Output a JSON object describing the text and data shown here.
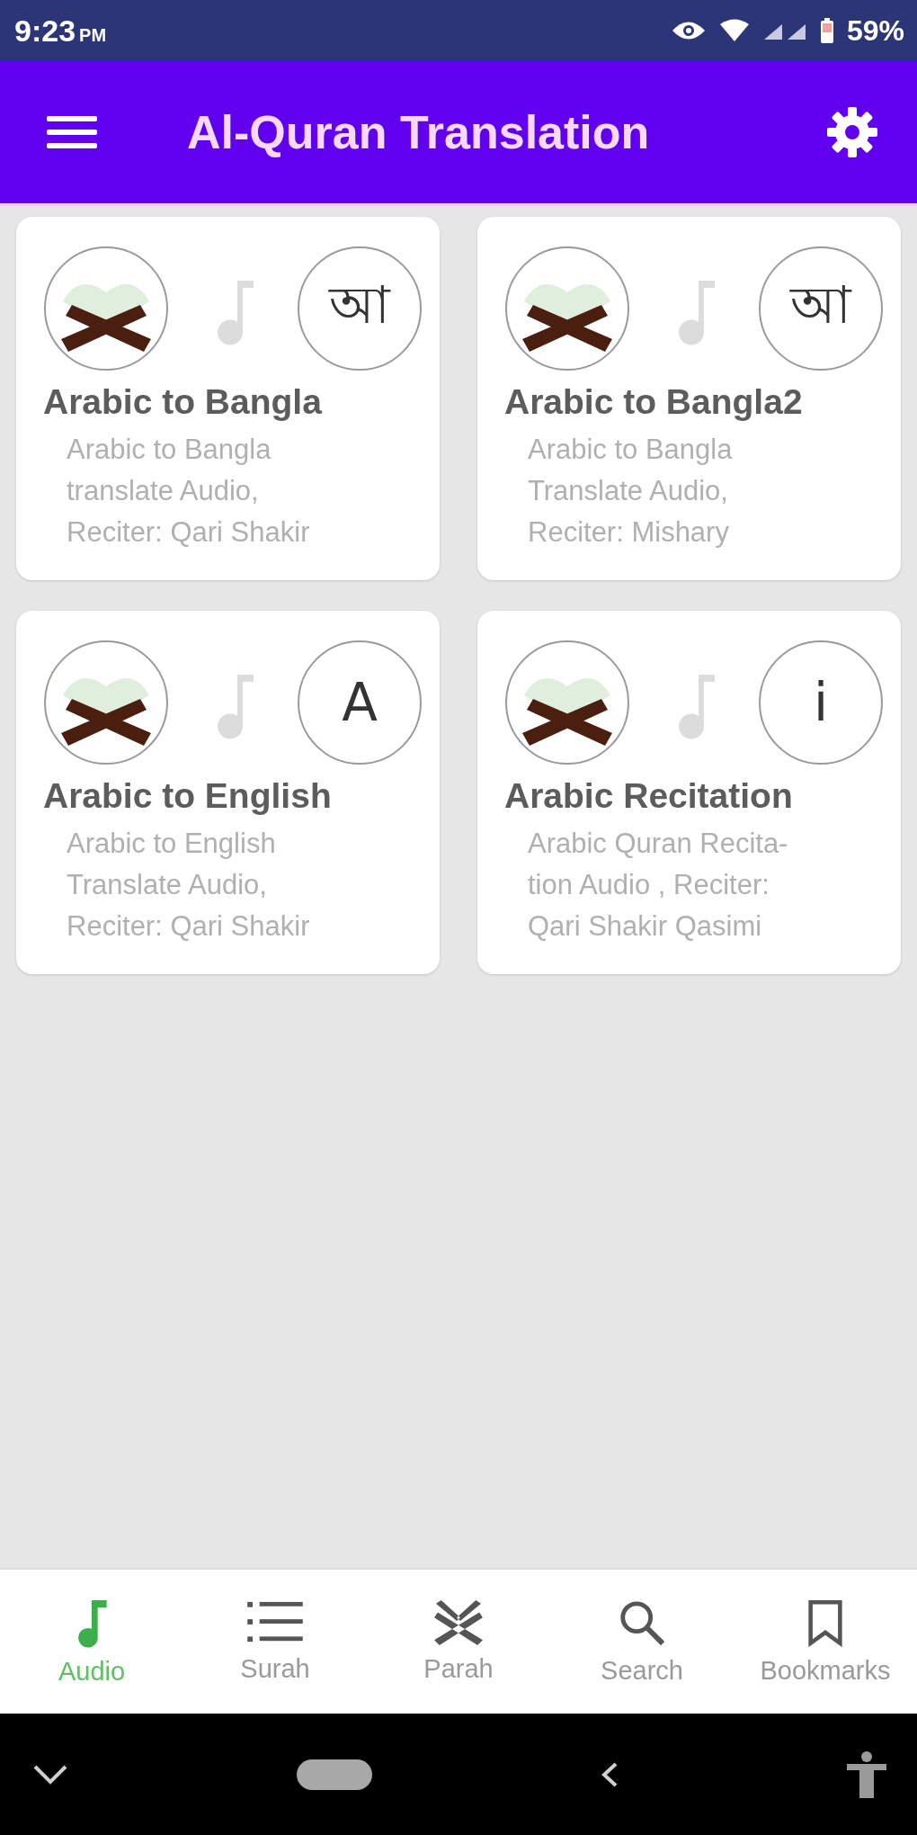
{
  "status_bar": {
    "time": "9:23",
    "meridiem": "PM",
    "battery": "59%"
  },
  "app_bar": {
    "title": "Al-Quran Translation"
  },
  "cards": [
    {
      "title": "Arabic to Bangla",
      "badge": "আ",
      "description_lines": [
        "Arabic to Bangla",
        "translate Audio,",
        "Reciter: Qari Shakir"
      ]
    },
    {
      "title": "Arabic to Bangla2",
      "badge": "আ",
      "description_lines": [
        "Arabic to Bangla",
        "Translate Audio,",
        "Reciter: Mishary"
      ]
    },
    {
      "title": "Arabic to English",
      "badge": "A",
      "description_lines": [
        "Arabic to English",
        "Translate Audio,",
        "Reciter: Qari Shakir"
      ]
    },
    {
      "title": "Arabic Recitation",
      "badge": "i",
      "description_lines": [
        "Arabic Quran Recita-",
        "tion Audio , Reciter:",
        "Qari Shakir Qasimi"
      ]
    }
  ],
  "bottom_nav": [
    {
      "kind": "audio",
      "label": "Audio",
      "selected": true
    },
    {
      "kind": "surah",
      "label": "Surah",
      "selected": false
    },
    {
      "kind": "parah",
      "label": "Parah",
      "selected": false
    },
    {
      "kind": "search",
      "label": "Search",
      "selected": false
    },
    {
      "kind": "bookmarks",
      "label": "Bookmarks",
      "selected": false
    }
  ]
}
